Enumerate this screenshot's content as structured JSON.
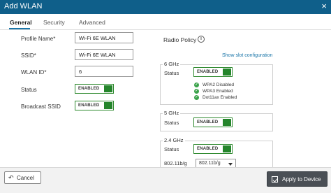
{
  "dialog": {
    "title": "Add WLAN",
    "close_glyph": "×"
  },
  "tabs": [
    {
      "label": "General",
      "active": true
    },
    {
      "label": "Security",
      "active": false
    },
    {
      "label": "Advanced",
      "active": false
    }
  ],
  "form": {
    "profile_name": {
      "label": "Profile Name*",
      "value": "Wi-Fi 6E WLAN"
    },
    "ssid": {
      "label": "SSID*",
      "value": "Wi-Fi 6E WLAN"
    },
    "wlan_id": {
      "label": "WLAN ID*",
      "value": "6"
    },
    "status": {
      "label": "Status",
      "toggle": "ENABLED"
    },
    "broadcast_ssid": {
      "label": "Broadcast SSID",
      "toggle": "ENABLED"
    }
  },
  "radio_policy": {
    "title": "Radio Policy",
    "info_glyph": "i",
    "show_slot_link": "Show slot configuration",
    "ghz6": {
      "legend": "6 GHz",
      "status_label": "Status",
      "toggle": "ENABLED",
      "checks": [
        "WPA2 Disabled",
        "WPA3 Enabled",
        "Dot11ax Enabled"
      ]
    },
    "ghz5": {
      "legend": "5 GHz",
      "status_label": "Status",
      "toggle": "ENABLED"
    },
    "ghz24": {
      "legend": "2.4 GHz",
      "status_label": "Status",
      "toggle": "ENABLED",
      "band_label": "802.11b/g",
      "band_value": "802.11b/g"
    }
  },
  "footer": {
    "cancel_label": "Cancel",
    "cancel_icon": "↶",
    "apply_label": "Apply to Device"
  },
  "colors": {
    "title_bar": "#0f5f8a",
    "toggle_green": "#24852b",
    "link_blue": "#1a75a8",
    "apply_button": "#4a4f55"
  }
}
